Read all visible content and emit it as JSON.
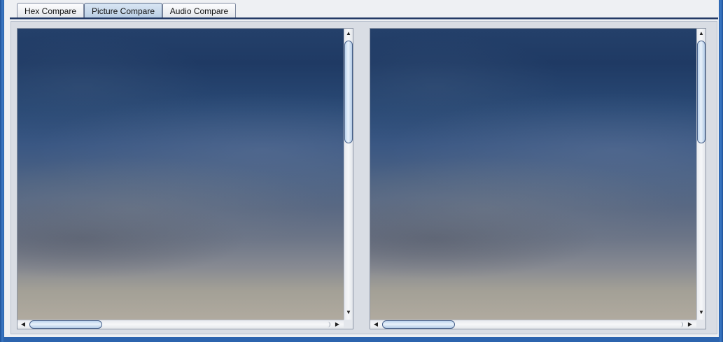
{
  "tabs": [
    {
      "label": "Hex Compare",
      "active": false
    },
    {
      "label": "Picture Compare",
      "active": true
    },
    {
      "label": "Audio Compare",
      "active": false
    }
  ],
  "viewers": [
    {
      "scroll_up": "▲",
      "scroll_down": "▼",
      "scroll_left": "◀",
      "scroll_right": "▶"
    },
    {
      "scroll_up": "▲",
      "scroll_down": "▼",
      "scroll_left": "◀",
      "scroll_right": "▶"
    }
  ],
  "colors": {
    "window_border": "#2c64ae",
    "active_tab": "#b8cde3",
    "scroll_thumb": "#d3e3f4"
  }
}
